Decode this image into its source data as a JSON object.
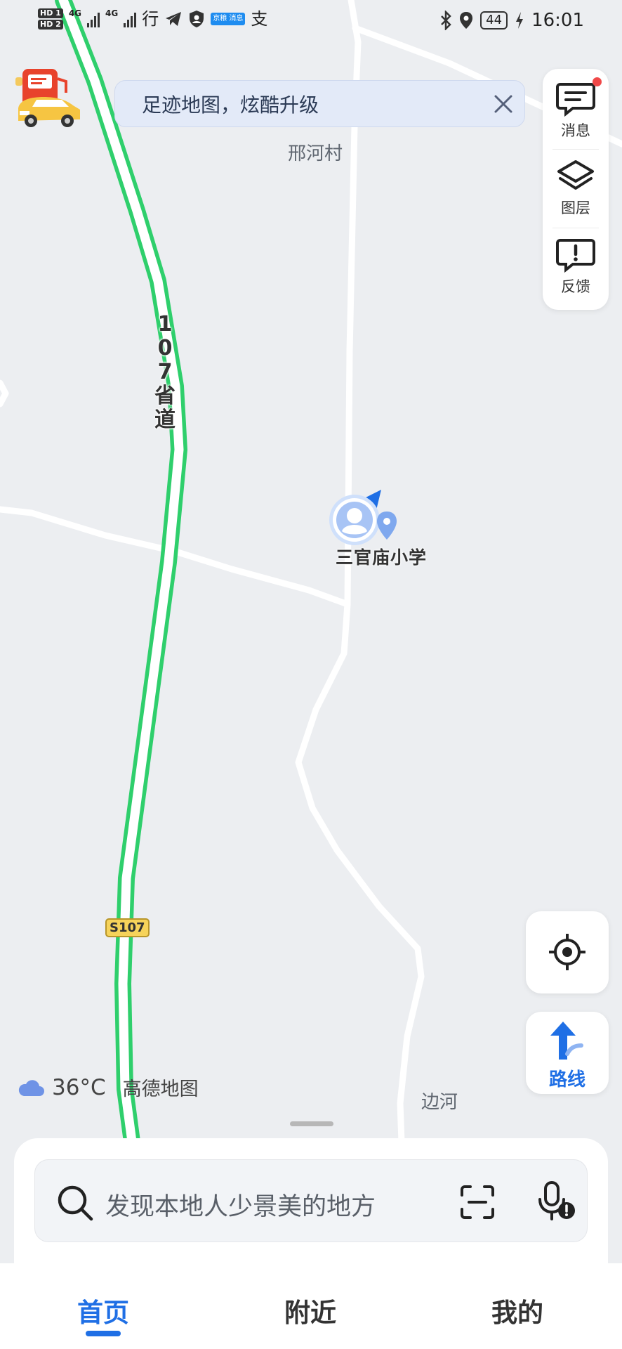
{
  "status_bar": {
    "hd1": "HD 1",
    "hd2": "HD 2",
    "net1": "4G",
    "net2": "4G",
    "app_hanzi_1": "行",
    "app_hanzi_2": "支",
    "app_badge": "京粮 消息",
    "battery": "44",
    "time": "16:01"
  },
  "banner": {
    "text": "足迹地图，炫酷升级"
  },
  "toolbar": {
    "messages_label": "消息",
    "layers_label": "图层",
    "feedback_label": "反馈"
  },
  "map": {
    "village_label": "邢河村",
    "school_label": "三官庙小学",
    "road_name_digits": [
      "1",
      "0",
      "7"
    ],
    "road_name_hanzi": [
      "省",
      "道"
    ],
    "road_shield": "S107",
    "bianhe_label": "边河"
  },
  "route_button": {
    "label": "路线"
  },
  "weather": {
    "temp": "36°C",
    "brand": "高德地图"
  },
  "search": {
    "placeholder": "发现本地人少景美的地方"
  },
  "tabs": [
    {
      "label": "首页",
      "active": true
    },
    {
      "label": "附近",
      "active": false
    },
    {
      "label": "我的",
      "active": false
    }
  ],
  "colors": {
    "accent": "#1f6fe5",
    "highway": "#2fcf6c",
    "notification_dot": "#f04848"
  }
}
